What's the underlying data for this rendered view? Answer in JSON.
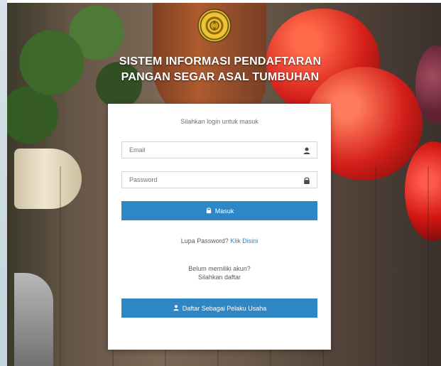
{
  "header": {
    "title_line1": "SISTEM INFORMASI PENDAFTARAN",
    "title_line2": "PANGAN SEGAR ASAL TUMBUHAN"
  },
  "login": {
    "hint": "Silahkan login untuk masuk",
    "email_placeholder": "Email",
    "password_placeholder": "Password",
    "submit_label": "Masuk",
    "forgot_prefix": "Lupa Password?",
    "forgot_link": "Klik Disini",
    "noacc_line1": "Belum memiliki akun?",
    "noacc_line2": "Silahkan daftar",
    "register_label": "Daftar Sebagai Pelaku Usaha"
  },
  "icons": {
    "email_field": "user-icon",
    "password_field": "lock-icon",
    "submit_button": "lock-icon",
    "register_button": "user-icon"
  },
  "colors": {
    "primary": "#2f86c4",
    "card_bg": "#ffffff"
  }
}
